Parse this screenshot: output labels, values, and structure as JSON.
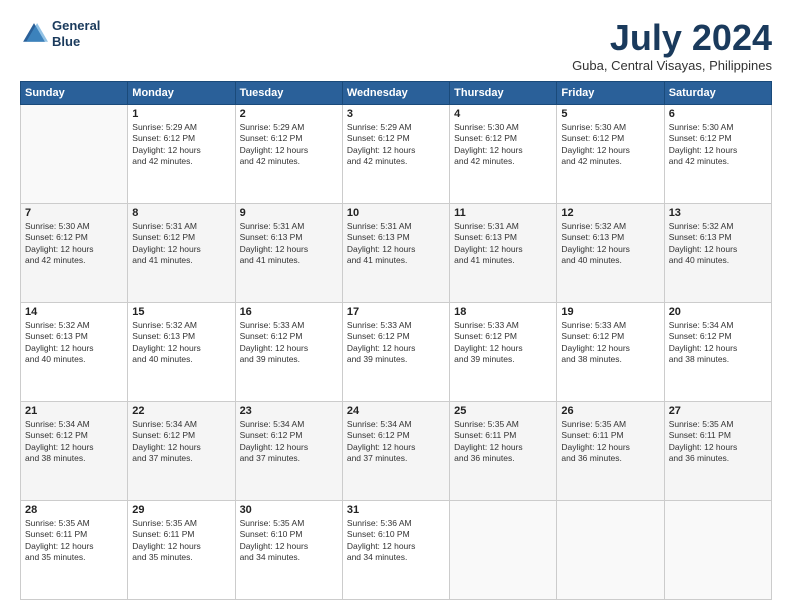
{
  "logo": {
    "line1": "General",
    "line2": "Blue"
  },
  "title": "July 2024",
  "location": "Guba, Central Visayas, Philippines",
  "days_header": [
    "Sunday",
    "Monday",
    "Tuesday",
    "Wednesday",
    "Thursday",
    "Friday",
    "Saturday"
  ],
  "weeks": [
    [
      {
        "day": "",
        "info": ""
      },
      {
        "day": "1",
        "info": "Sunrise: 5:29 AM\nSunset: 6:12 PM\nDaylight: 12 hours\nand 42 minutes."
      },
      {
        "day": "2",
        "info": "Sunrise: 5:29 AM\nSunset: 6:12 PM\nDaylight: 12 hours\nand 42 minutes."
      },
      {
        "day": "3",
        "info": "Sunrise: 5:29 AM\nSunset: 6:12 PM\nDaylight: 12 hours\nand 42 minutes."
      },
      {
        "day": "4",
        "info": "Sunrise: 5:30 AM\nSunset: 6:12 PM\nDaylight: 12 hours\nand 42 minutes."
      },
      {
        "day": "5",
        "info": "Sunrise: 5:30 AM\nSunset: 6:12 PM\nDaylight: 12 hours\nand 42 minutes."
      },
      {
        "day": "6",
        "info": "Sunrise: 5:30 AM\nSunset: 6:12 PM\nDaylight: 12 hours\nand 42 minutes."
      }
    ],
    [
      {
        "day": "7",
        "info": "Sunrise: 5:30 AM\nSunset: 6:12 PM\nDaylight: 12 hours\nand 42 minutes."
      },
      {
        "day": "8",
        "info": "Sunrise: 5:31 AM\nSunset: 6:12 PM\nDaylight: 12 hours\nand 41 minutes."
      },
      {
        "day": "9",
        "info": "Sunrise: 5:31 AM\nSunset: 6:13 PM\nDaylight: 12 hours\nand 41 minutes."
      },
      {
        "day": "10",
        "info": "Sunrise: 5:31 AM\nSunset: 6:13 PM\nDaylight: 12 hours\nand 41 minutes."
      },
      {
        "day": "11",
        "info": "Sunrise: 5:31 AM\nSunset: 6:13 PM\nDaylight: 12 hours\nand 41 minutes."
      },
      {
        "day": "12",
        "info": "Sunrise: 5:32 AM\nSunset: 6:13 PM\nDaylight: 12 hours\nand 40 minutes."
      },
      {
        "day": "13",
        "info": "Sunrise: 5:32 AM\nSunset: 6:13 PM\nDaylight: 12 hours\nand 40 minutes."
      }
    ],
    [
      {
        "day": "14",
        "info": "Sunrise: 5:32 AM\nSunset: 6:13 PM\nDaylight: 12 hours\nand 40 minutes."
      },
      {
        "day": "15",
        "info": "Sunrise: 5:32 AM\nSunset: 6:13 PM\nDaylight: 12 hours\nand 40 minutes."
      },
      {
        "day": "16",
        "info": "Sunrise: 5:33 AM\nSunset: 6:12 PM\nDaylight: 12 hours\nand 39 minutes."
      },
      {
        "day": "17",
        "info": "Sunrise: 5:33 AM\nSunset: 6:12 PM\nDaylight: 12 hours\nand 39 minutes."
      },
      {
        "day": "18",
        "info": "Sunrise: 5:33 AM\nSunset: 6:12 PM\nDaylight: 12 hours\nand 39 minutes."
      },
      {
        "day": "19",
        "info": "Sunrise: 5:33 AM\nSunset: 6:12 PM\nDaylight: 12 hours\nand 38 minutes."
      },
      {
        "day": "20",
        "info": "Sunrise: 5:34 AM\nSunset: 6:12 PM\nDaylight: 12 hours\nand 38 minutes."
      }
    ],
    [
      {
        "day": "21",
        "info": "Sunrise: 5:34 AM\nSunset: 6:12 PM\nDaylight: 12 hours\nand 38 minutes."
      },
      {
        "day": "22",
        "info": "Sunrise: 5:34 AM\nSunset: 6:12 PM\nDaylight: 12 hours\nand 37 minutes."
      },
      {
        "day": "23",
        "info": "Sunrise: 5:34 AM\nSunset: 6:12 PM\nDaylight: 12 hours\nand 37 minutes."
      },
      {
        "day": "24",
        "info": "Sunrise: 5:34 AM\nSunset: 6:12 PM\nDaylight: 12 hours\nand 37 minutes."
      },
      {
        "day": "25",
        "info": "Sunrise: 5:35 AM\nSunset: 6:11 PM\nDaylight: 12 hours\nand 36 minutes."
      },
      {
        "day": "26",
        "info": "Sunrise: 5:35 AM\nSunset: 6:11 PM\nDaylight: 12 hours\nand 36 minutes."
      },
      {
        "day": "27",
        "info": "Sunrise: 5:35 AM\nSunset: 6:11 PM\nDaylight: 12 hours\nand 36 minutes."
      }
    ],
    [
      {
        "day": "28",
        "info": "Sunrise: 5:35 AM\nSunset: 6:11 PM\nDaylight: 12 hours\nand 35 minutes."
      },
      {
        "day": "29",
        "info": "Sunrise: 5:35 AM\nSunset: 6:11 PM\nDaylight: 12 hours\nand 35 minutes."
      },
      {
        "day": "30",
        "info": "Sunrise: 5:35 AM\nSunset: 6:10 PM\nDaylight: 12 hours\nand 34 minutes."
      },
      {
        "day": "31",
        "info": "Sunrise: 5:36 AM\nSunset: 6:10 PM\nDaylight: 12 hours\nand 34 minutes."
      },
      {
        "day": "",
        "info": ""
      },
      {
        "day": "",
        "info": ""
      },
      {
        "day": "",
        "info": ""
      }
    ]
  ]
}
